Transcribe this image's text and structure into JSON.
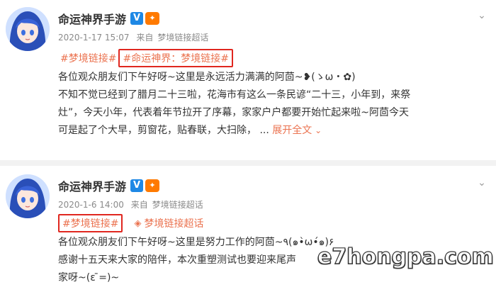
{
  "posts": [
    {
      "username": "命运神界手游",
      "verified_mark": "V",
      "badge_icon": "vip-badge-icon",
      "meta": {
        "datetime": "2020-1-17 15:07",
        "source_prefix": "来自",
        "source": "梦境链接超话"
      },
      "tags": [
        "#梦境链接#",
        "#命运神界：梦境链接#"
      ],
      "lines": [
        "各位观众朋友们下午好呀~这里是永远活力满满的阿茴~❥(ゝω・✿)",
        "不知不觉已经到了腊月二十三啦，花海市有这么一条民谚“二十三，小年到，来祭",
        "灶”，今天小年，代表着年节拉开了序幕，家家户户都要开始忙起来啦~阿茴今天",
        "可是起了个大早，剪窗花，贴春联，大扫除，  ..."
      ],
      "expand_label": "展开全文"
    },
    {
      "username": "命运神界手游",
      "verified_mark": "V",
      "badge_icon": "vip-badge-icon",
      "meta": {
        "datetime": "2020-1-6 14:00",
        "source_prefix": "来自",
        "source": "梦境链接超话"
      },
      "tags": [
        "#梦境链接#"
      ],
      "super_topic": "梦境链接超话",
      "lines": [
        "各位观众朋友们下午好呀~这里是努力工作的阿茴~٩(๑•̀ω•́๑)۶",
        "感谢十五天来大家的陪伴，本次重塑测试也要迎来尾声",
        "家呀~(ε ̄=)~"
      ]
    }
  ],
  "icons": {
    "more": "chevron-down-icon",
    "super_topic": "super-topic-diamond-icon"
  },
  "colors": {
    "link": "#eb7350",
    "highlight_box": "#e0271f",
    "verified": "#1e88e5"
  },
  "watermark": "e7hongpa.com"
}
